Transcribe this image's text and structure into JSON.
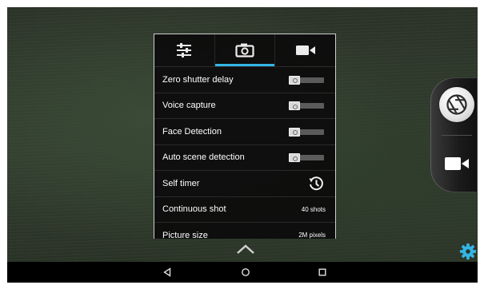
{
  "settings_panel": {
    "tabs": [
      {
        "icon": "sliders-icon",
        "active": false
      },
      {
        "icon": "camera-icon",
        "active": true
      },
      {
        "icon": "video-camera-icon",
        "active": false
      }
    ],
    "rows": [
      {
        "label": "Zero shutter delay",
        "control": "switch",
        "on": false
      },
      {
        "label": "Voice capture",
        "control": "switch",
        "on": false
      },
      {
        "label": "Face Detection",
        "control": "switch",
        "on": false
      },
      {
        "label": "Auto scene detection",
        "control": "switch",
        "on": false
      },
      {
        "label": "Self timer",
        "control": "timer-icon"
      },
      {
        "label": "Continuous shot",
        "value": "40 shots"
      },
      {
        "label": "Picture size",
        "value": "2M pixels"
      }
    ]
  },
  "side_controls": {
    "shutter_icon": "aperture-icon",
    "video_icon": "video-camera-icon",
    "settings_icon": "gear-icon"
  },
  "nav": {
    "icons": [
      "back-icon",
      "home-icon",
      "recents-icon"
    ]
  },
  "colors": {
    "accent": "#33b5e5",
    "gear": "#33b5e5",
    "panel_border": "#cfcfcf",
    "navbar": "#000000"
  }
}
